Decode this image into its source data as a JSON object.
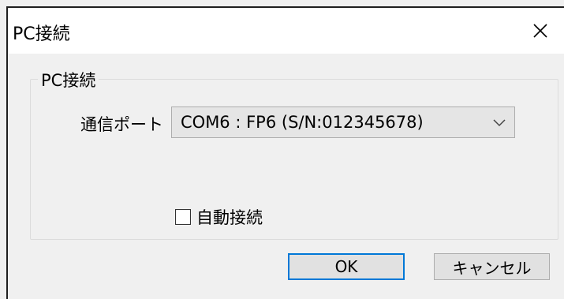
{
  "window": {
    "title": "PC接続",
    "close_glyph": "✕"
  },
  "group": {
    "legend": "PC接続"
  },
  "port": {
    "label": "通信ポート",
    "selected_value": "COM6 : FP6 (S/N:012345678)"
  },
  "auto_connect": {
    "label": "自動接続",
    "checked": false
  },
  "buttons": {
    "ok": "OK",
    "cancel": "キャンセル"
  },
  "colors": {
    "default_button_border": "#0078d7",
    "dialog_background": "#f0f0f0",
    "titlebar_background": "#ffffff"
  },
  "icons": {
    "close": "close-icon",
    "dropdown": "chevron-down-icon"
  }
}
